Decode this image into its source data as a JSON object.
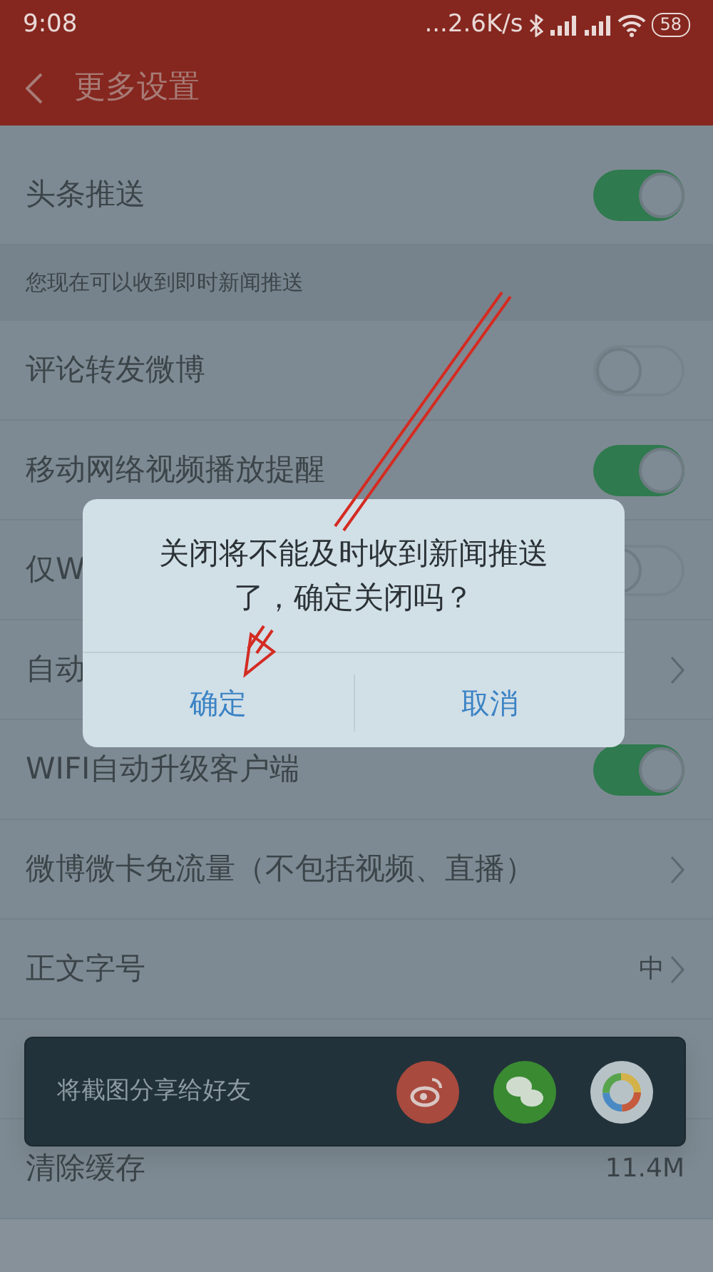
{
  "status_bar": {
    "time": "9:08",
    "network_speed": "...2.6K/s",
    "battery": "58"
  },
  "header": {
    "title": "更多设置"
  },
  "settings": [
    {
      "kind": "toggle",
      "label": "头条推送",
      "on": true
    },
    {
      "kind": "note",
      "label": "您现在可以收到即时新闻推送"
    },
    {
      "kind": "toggle",
      "label": "评论转发微博",
      "on": false
    },
    {
      "kind": "toggle",
      "label": "移动网络视频播放提醒",
      "on": true
    },
    {
      "kind": "toggle",
      "label": "仅W",
      "on": false
    },
    {
      "kind": "link",
      "label": "自动"
    },
    {
      "kind": "toggle",
      "label": "WIFI自动升级客户端",
      "on": true
    },
    {
      "kind": "link",
      "label": "微博微卡免流量（不包括视频、直播）"
    },
    {
      "kind": "link",
      "label": "正文字号",
      "value": "中"
    },
    {
      "kind": "hidden"
    },
    {
      "kind": "value",
      "label": "清除缓存",
      "value": "11.4M"
    }
  ],
  "dialog": {
    "message": "关闭将不能及时收到新闻推送了，确定关闭吗？",
    "buttons": [
      "确定",
      "取消"
    ]
  },
  "share_toast": {
    "text": "将截图分享给好友"
  }
}
